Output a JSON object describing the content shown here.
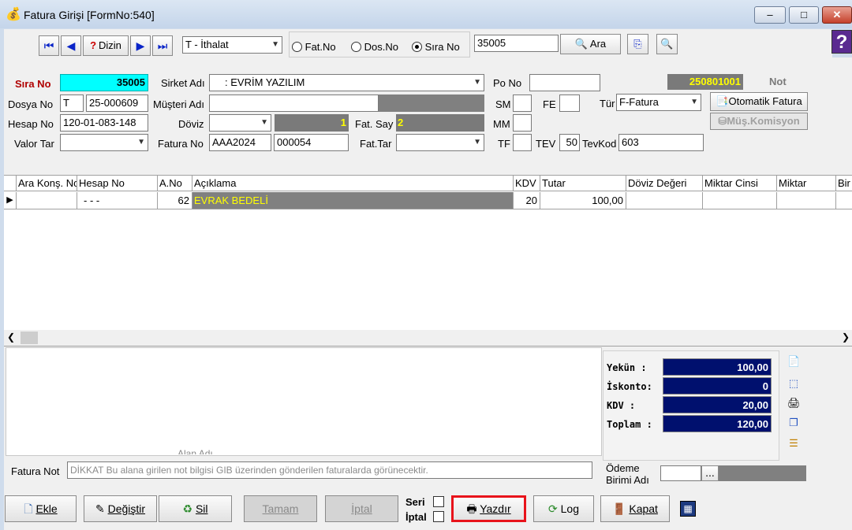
{
  "window": {
    "title": "Fatura Girişi [FormNo:540]",
    "min_glyph": "–",
    "max_glyph": "□",
    "close_glyph": "✕"
  },
  "toolbar": {
    "dizin_label": "Dizin",
    "type_select": "T - İthalat",
    "radio_fatno": "Fat.No",
    "radio_dosno": "Dos.No",
    "radio_sirano": "Sıra No",
    "search_value": "35005",
    "search_button": "Ara",
    "help_glyph": "?"
  },
  "form": {
    "sira_no_label": "Sıra No",
    "sira_no_value": "35005",
    "sirket_adi_label": "Sirket Adı",
    "sirket_adi_value": ": EVRİM YAZILIM",
    "po_no_label": "Po No",
    "po_no_value": "",
    "doc_number": "250801001",
    "not_label": "Not",
    "dosya_no_label": "Dosya No",
    "dosya_no_prefix": "T",
    "dosya_no_value": "25-000609",
    "musteri_adi_label": "Müşteri Adı",
    "sm_label": "SM",
    "fe_label": "FE",
    "tur_label": "Tür",
    "tur_value": "F-Fatura",
    "otomatik_fatura_button": "Otomatik Fatura",
    "hesap_no_label": "Hesap No",
    "hesap_no_value": "120-01-083-148",
    "doviz_label": "Döviz",
    "doviz_rate": "1",
    "fat_say_label": "Fat. Say",
    "fat_say_value": "2",
    "mm_label": "MM",
    "mus_komisyon_button": "Müş.Komisyon",
    "valor_tar_label": "Valor Tar",
    "fatura_no_label": "Fatura No",
    "fatura_no_series": "AAA2024",
    "fatura_no_value": "000054",
    "fat_tar_label": "Fat.Tar",
    "tf_label": "TF",
    "tev_label": "TEV",
    "tev_value": "50",
    "tevkod_label": "TevKod",
    "tevkod_value": "603"
  },
  "grid": {
    "columns": [
      "Ara Konş. No",
      "Hesap No",
      "A.No",
      "Açıklama",
      "KDV",
      "Tutar",
      "Döviz Değeri",
      "Miktar Cinsi",
      "Miktar",
      "Bir"
    ],
    "row": {
      "hesap_no": "- - -",
      "a_no": "62",
      "aciklama": "EVRAK BEDELİ",
      "kdv": "20",
      "tutar": "100,00"
    }
  },
  "summary": {
    "yekun_label": "Yekün   :",
    "yekun_value": "100,00",
    "iskonto_label": "İskonto:",
    "iskonto_value": "0",
    "kdv_label": "KDV     :",
    "kdv_value": "20,00",
    "toplam_label": "Toplam  :",
    "toplam_value": "120,00"
  },
  "footer": {
    "fatura_not_label": "Fatura Not",
    "fatura_not_placeholder": "DİKKAT Bu alana girilen not bilgisi GIB üzerinden gönderilen faturalarda görünecektir.",
    "odeme_label": "Ödeme Birimi Adı",
    "odeme_button": "...",
    "hidden_label": "Alan Adı"
  },
  "buttons": {
    "ekle": "Ekle",
    "degistir": "Değiştir",
    "sil": "Sil",
    "tamam": "Tamam",
    "iptal": "İptal",
    "seri_label": "Seri",
    "iptal_check_label": "İptal",
    "yazdir": "Yazdır",
    "log": "Log",
    "kapat": "Kapat"
  },
  "colors": {
    "accent_cyan": "#00ffff",
    "navy": "#00106e",
    "gray_field": "#808080",
    "yellow_text": "#ffff00",
    "highlight_red": "#e8131b"
  }
}
